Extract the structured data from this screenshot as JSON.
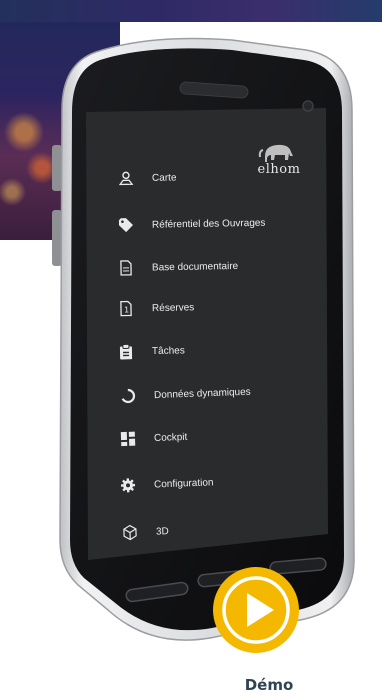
{
  "logo": {
    "brand": "elhom",
    "tagline": "elhom"
  },
  "menu": {
    "items": [
      {
        "label": "Carte",
        "icon": "map-pin-icon"
      },
      {
        "label": "Référentiel des Ouvrages",
        "icon": "tag-icon"
      },
      {
        "label": "Base documentaire",
        "icon": "document-icon"
      },
      {
        "label": "Réserves",
        "icon": "reserve-doc-icon"
      },
      {
        "label": "Tâches",
        "icon": "clipboard-icon"
      },
      {
        "label": "Données dynamiques",
        "icon": "circle-sync-icon"
      },
      {
        "label": "Cockpit",
        "icon": "dashboard-icon"
      },
      {
        "label": "Configuration",
        "icon": "gear-icon"
      },
      {
        "label": "3D",
        "icon": "cube-icon"
      }
    ]
  },
  "demo": {
    "label": "Démo",
    "icon": "play-icon",
    "accent": "#f5b800"
  },
  "colors": {
    "screen": "#2a2b2d",
    "bezel": "#111214",
    "frame": "#d3d4d6"
  }
}
